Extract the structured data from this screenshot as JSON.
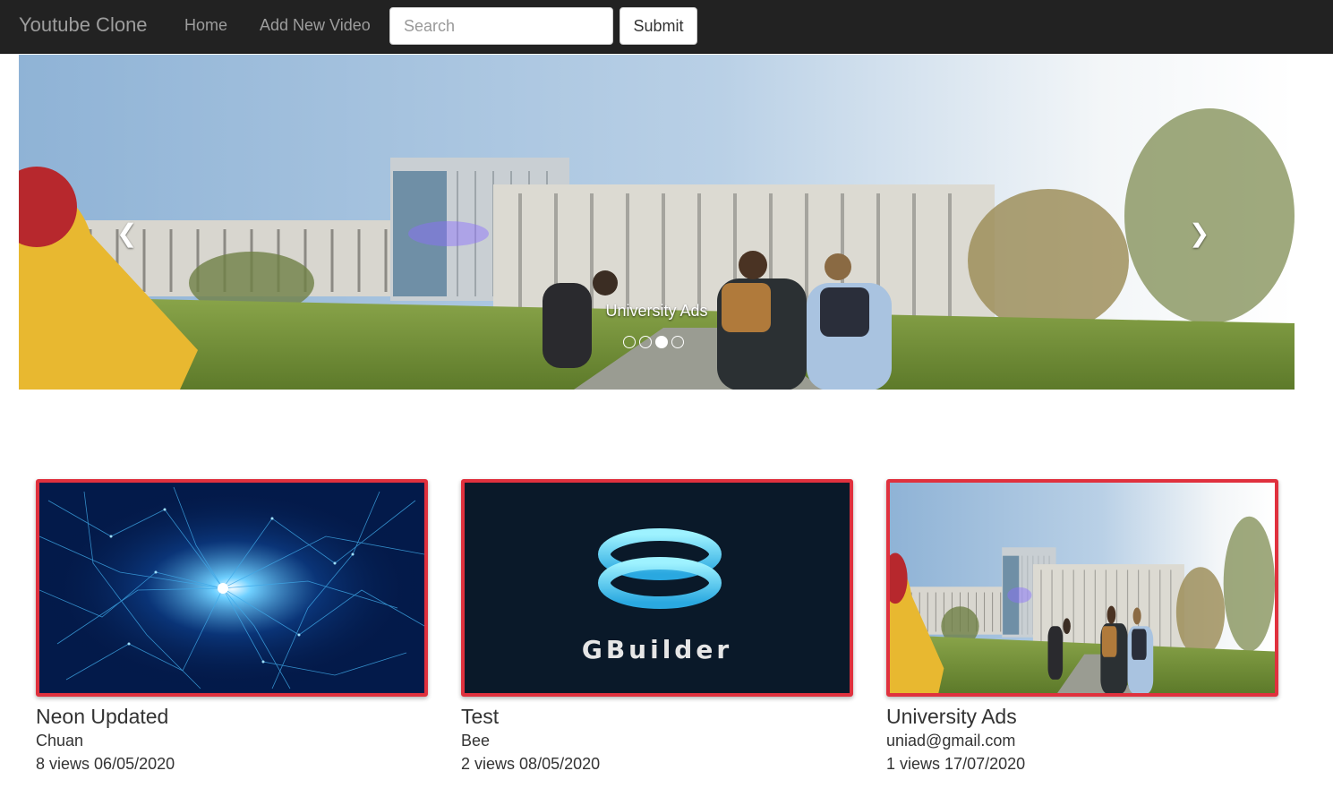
{
  "navbar": {
    "brand": "Youtube Clone",
    "links": [
      {
        "label": "Home"
      },
      {
        "label": "Add New Video"
      }
    ],
    "search": {
      "placeholder": "Search",
      "value": ""
    },
    "submit_label": "Submit"
  },
  "carousel": {
    "caption": "University Ads",
    "slide_count": 4,
    "active_index": 2,
    "prev_icon": "chevron-left-icon",
    "next_icon": "chevron-right-icon"
  },
  "videos": [
    {
      "title": "Neon Updated",
      "author": "Chuan",
      "views": "8 views",
      "date": "06/05/2020",
      "thumbnail": "neon-network"
    },
    {
      "title": "Test",
      "author": "Bee",
      "views": "2 views",
      "date": "08/05/2020",
      "thumbnail": "gbuilder-logo",
      "thumbnail_text": "GBuilder"
    },
    {
      "title": "University Ads",
      "author": "uniad@gmail.com",
      "views": "1 views",
      "date": "17/07/2020",
      "thumbnail": "university-campus"
    }
  ],
  "colors": {
    "navbar_bg": "#222222",
    "nav_text": "#9d9d9d",
    "card_border": "#e0313e"
  }
}
